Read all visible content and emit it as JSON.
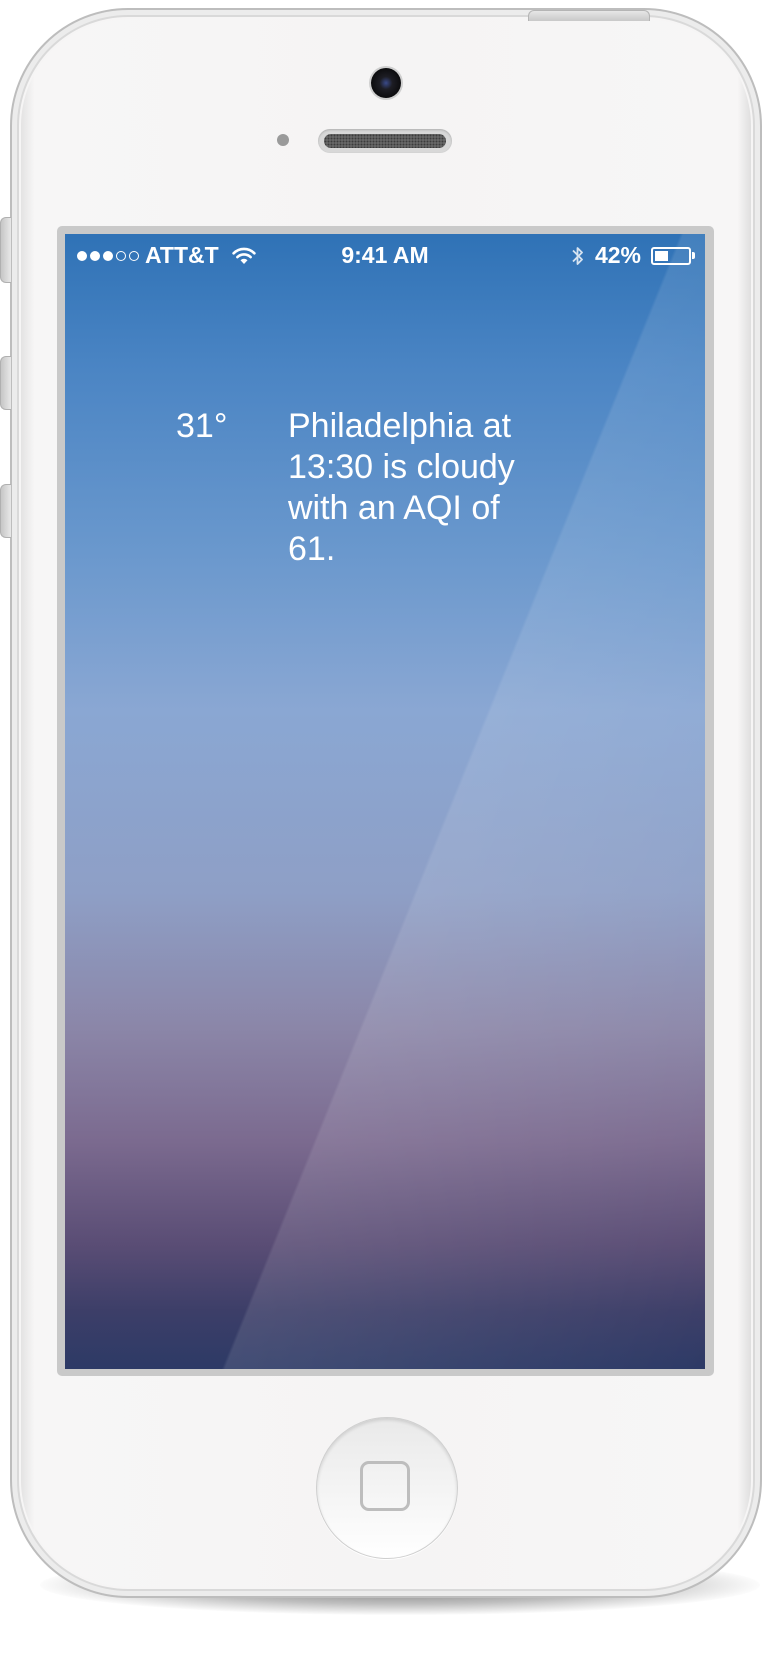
{
  "status_bar": {
    "signal_strength": 3,
    "signal_max": 5,
    "carrier": "ATT&T",
    "time": "9:41 AM",
    "battery_percent_label": "42%",
    "battery_level": 0.42
  },
  "weather": {
    "temperature": "31°",
    "summary": "Philadelphia at 13:30 is cloudy with an AQI of 61."
  },
  "icons": [
    "wifi-icon",
    "bluetooth-icon",
    "battery-icon",
    "camera-icon",
    "home-button-icon"
  ],
  "colors": {
    "sky_top": "#2f72b6",
    "sky_mid": "#8aa7d3",
    "sky_bottom": "#2d3a66",
    "text": "#ffffff",
    "device_body": "#f5f4f4"
  }
}
